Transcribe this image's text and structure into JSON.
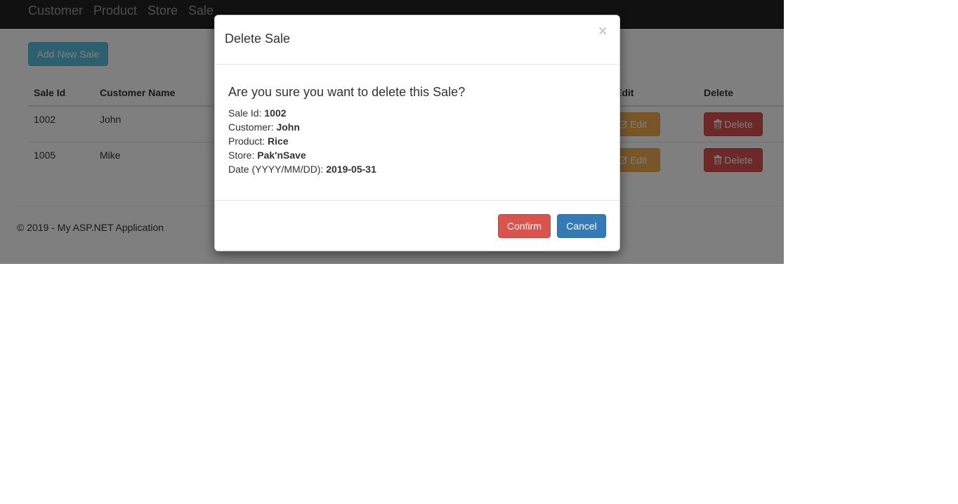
{
  "navbar": {
    "items": [
      {
        "label": "Customer"
      },
      {
        "label": "Product"
      },
      {
        "label": "Store"
      },
      {
        "label": "Sale"
      }
    ]
  },
  "actions": {
    "add_label": "Add New Sale"
  },
  "table": {
    "headers": [
      "Sale Id",
      "Customer Name",
      "Edit",
      "Delete"
    ],
    "rows": [
      {
        "sale_id": "1002",
        "customer": "John",
        "edit_label": "Edit",
        "delete_label": "Delete"
      },
      {
        "sale_id": "1005",
        "customer": "Mike",
        "edit_label": "Edit",
        "delete_label": "Delete"
      }
    ]
  },
  "footer": {
    "text": "© 2019 - My ASP.NET Application"
  },
  "modal": {
    "title": "Delete Sale",
    "close_glyph": "×",
    "question": "Are you sure you want to delete this Sale?",
    "details": [
      {
        "label": "Sale Id:",
        "value": "1002"
      },
      {
        "label": "Customer:",
        "value": "John"
      },
      {
        "label": "Product:",
        "value": "Rice"
      },
      {
        "label": "Store:",
        "value": "Pak'nSave"
      },
      {
        "label": "Date (YYYY/MM/DD):",
        "value": "2019-05-31"
      }
    ],
    "confirm_label": "Confirm",
    "cancel_label": "Cancel"
  },
  "colors": {
    "navbar_bg": "#222222",
    "info": "#5bc0de",
    "warning": "#f0ad4e",
    "danger": "#d9534f",
    "primary": "#337ab7"
  },
  "icons": {
    "edit": "pencil-square-icon",
    "delete": "trash-icon",
    "close": "close-icon"
  }
}
